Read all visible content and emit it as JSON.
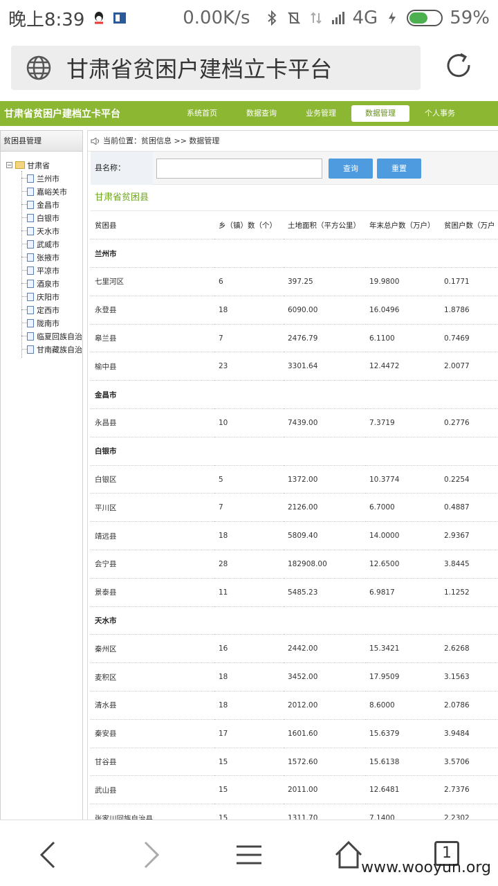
{
  "status": {
    "time": "晚上8:39",
    "speed": "0.00K/s",
    "network": "4G",
    "battery": "59%",
    "battery_level": 0.59
  },
  "browser": {
    "address": "甘肃省贫困户建档立卡平台"
  },
  "site": {
    "brand": "甘肃省贫困户建档立卡平台",
    "nav": [
      "系统首页",
      "数据查询",
      "业务管理",
      "数据管理",
      "个人事务"
    ],
    "active_nav_index": 3
  },
  "sidebar": {
    "header": "贫困县管理",
    "root": "甘肃省",
    "items": [
      "兰州市",
      "嘉峪关市",
      "金昌市",
      "白银市",
      "天水市",
      "武威市",
      "张掖市",
      "平凉市",
      "酒泉市",
      "庆阳市",
      "定西市",
      "陇南市",
      "临夏回族自治",
      "甘南藏族自治"
    ]
  },
  "main": {
    "breadcrumb": "当前位置：贫困信息 >> 数据管理",
    "search_label": "县名称：",
    "search_value": "",
    "query_button": "查询",
    "reset_button": "重置",
    "section_title": "甘肃省贫困县",
    "columns": [
      "贫困县",
      "乡（镇）数（个）",
      "土地面积（平方公里）",
      "年末总户数（万户）",
      "贫困户数（万户"
    ],
    "rows": [
      {
        "type": "group",
        "name": "兰州市"
      },
      {
        "type": "row",
        "cells": [
          "七里河区",
          "6",
          "397.25",
          "19.9800",
          "0.1771"
        ]
      },
      {
        "type": "row",
        "cells": [
          "永登县",
          "18",
          "6090.00",
          "16.0496",
          "1.8786"
        ]
      },
      {
        "type": "row",
        "cells": [
          "皋兰县",
          "7",
          "2476.79",
          "6.1100",
          "0.7469"
        ]
      },
      {
        "type": "row",
        "cells": [
          "榆中县",
          "23",
          "3301.64",
          "12.4472",
          "2.0077"
        ]
      },
      {
        "type": "group",
        "name": "金昌市"
      },
      {
        "type": "row",
        "cells": [
          "永昌县",
          "10",
          "7439.00",
          "7.3719",
          "0.2776"
        ]
      },
      {
        "type": "group",
        "name": "白银市"
      },
      {
        "type": "row",
        "cells": [
          "白银区",
          "5",
          "1372.00",
          "10.3774",
          "0.2254"
        ]
      },
      {
        "type": "row",
        "cells": [
          "平川区",
          "7",
          "2126.00",
          "6.7000",
          "0.4887"
        ]
      },
      {
        "type": "row",
        "cells": [
          "靖远县",
          "18",
          "5809.40",
          "14.0000",
          "2.9367"
        ]
      },
      {
        "type": "row",
        "cells": [
          "会宁县",
          "28",
          "182908.00",
          "12.6500",
          "3.8445"
        ]
      },
      {
        "type": "row",
        "cells": [
          "景泰县",
          "11",
          "5485.23",
          "6.9817",
          "1.1252"
        ]
      },
      {
        "type": "group",
        "name": "天水市"
      },
      {
        "type": "row",
        "cells": [
          "秦州区",
          "16",
          "2442.00",
          "15.3421",
          "2.6268"
        ]
      },
      {
        "type": "row",
        "cells": [
          "麦积区",
          "18",
          "3452.00",
          "17.9509",
          "3.1563"
        ]
      },
      {
        "type": "row",
        "cells": [
          "清水县",
          "18",
          "2012.00",
          "8.6000",
          "2.0786"
        ]
      },
      {
        "type": "row",
        "cells": [
          "秦安县",
          "17",
          "1601.60",
          "15.6379",
          "3.9484"
        ]
      },
      {
        "type": "row",
        "cells": [
          "甘谷县",
          "15",
          "1572.60",
          "15.6138",
          "3.5706"
        ]
      },
      {
        "type": "row",
        "cells": [
          "武山县",
          "15",
          "2011.00",
          "12.6481",
          "2.7376"
        ]
      },
      {
        "type": "row",
        "cells": [
          "张家川回族自治县",
          "15",
          "1311.70",
          "7.1400",
          "2.2302"
        ]
      }
    ]
  },
  "bottom": {
    "tab_count": "1",
    "watermark": "www.wooyun.org"
  }
}
